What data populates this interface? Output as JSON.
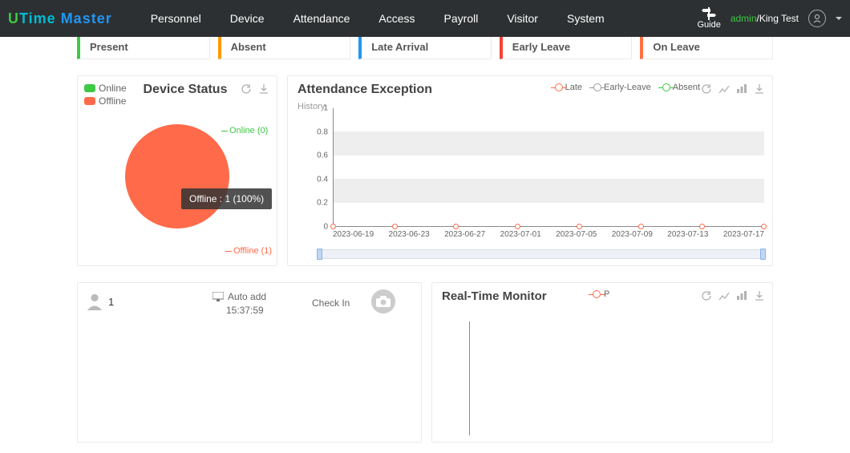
{
  "app": {
    "logo_u": "U",
    "logo_time": "Time",
    "logo_master": " Master"
  },
  "nav": {
    "items": [
      "Personnel",
      "Device",
      "Attendance",
      "Access",
      "Payroll",
      "Visitor",
      "System"
    ]
  },
  "header": {
    "guide": "Guide",
    "admin": "admin",
    "slash": "/",
    "company": "King Test"
  },
  "status_cards": [
    {
      "label": "Present",
      "cls": "present"
    },
    {
      "label": "Absent",
      "cls": "absent"
    },
    {
      "label": "Late Arrival",
      "cls": "late"
    },
    {
      "label": "Early Leave",
      "cls": "early"
    },
    {
      "label": "On Leave",
      "cls": "onleave"
    }
  ],
  "device_status": {
    "title": "Device Status",
    "legend_online": "Online",
    "legend_offline": "Offline",
    "label_online": "Online (0)",
    "label_offline": "Offline (1)",
    "tooltip": "Offline : 1 (100%)"
  },
  "attendance_exception": {
    "title": "Attendance Exception",
    "history": "History",
    "legend": {
      "late": "Late",
      "early": "Early-Leave",
      "absent": "Absent"
    }
  },
  "chart_data": {
    "type": "line",
    "title": "Attendance Exception",
    "xlabel": "",
    "ylabel": "",
    "ylim": [
      0,
      1
    ],
    "yticks": [
      0,
      0.2,
      0.4,
      0.6,
      0.8,
      1
    ],
    "categories": [
      "2023-06-19",
      "2023-06-23",
      "2023-06-27",
      "2023-07-01",
      "2023-07-05",
      "2023-07-09",
      "2023-07-13",
      "2023-07-17"
    ],
    "series": [
      {
        "name": "Late",
        "values": [
          0,
          0,
          0,
          0,
          0,
          0,
          0,
          0
        ]
      },
      {
        "name": "Early-Leave",
        "values": [
          0,
          0,
          0,
          0,
          0,
          0,
          0,
          0
        ]
      },
      {
        "name": "Absent",
        "values": [
          0,
          0,
          0,
          0,
          0,
          0,
          0,
          0
        ]
      }
    ]
  },
  "monitor_left": {
    "person_count": "1",
    "auto_add": "Auto add",
    "time": "15:37:59",
    "check_in": "Check In"
  },
  "realtime": {
    "title": "Real-Time Monitor",
    "legend_p": "P"
  }
}
